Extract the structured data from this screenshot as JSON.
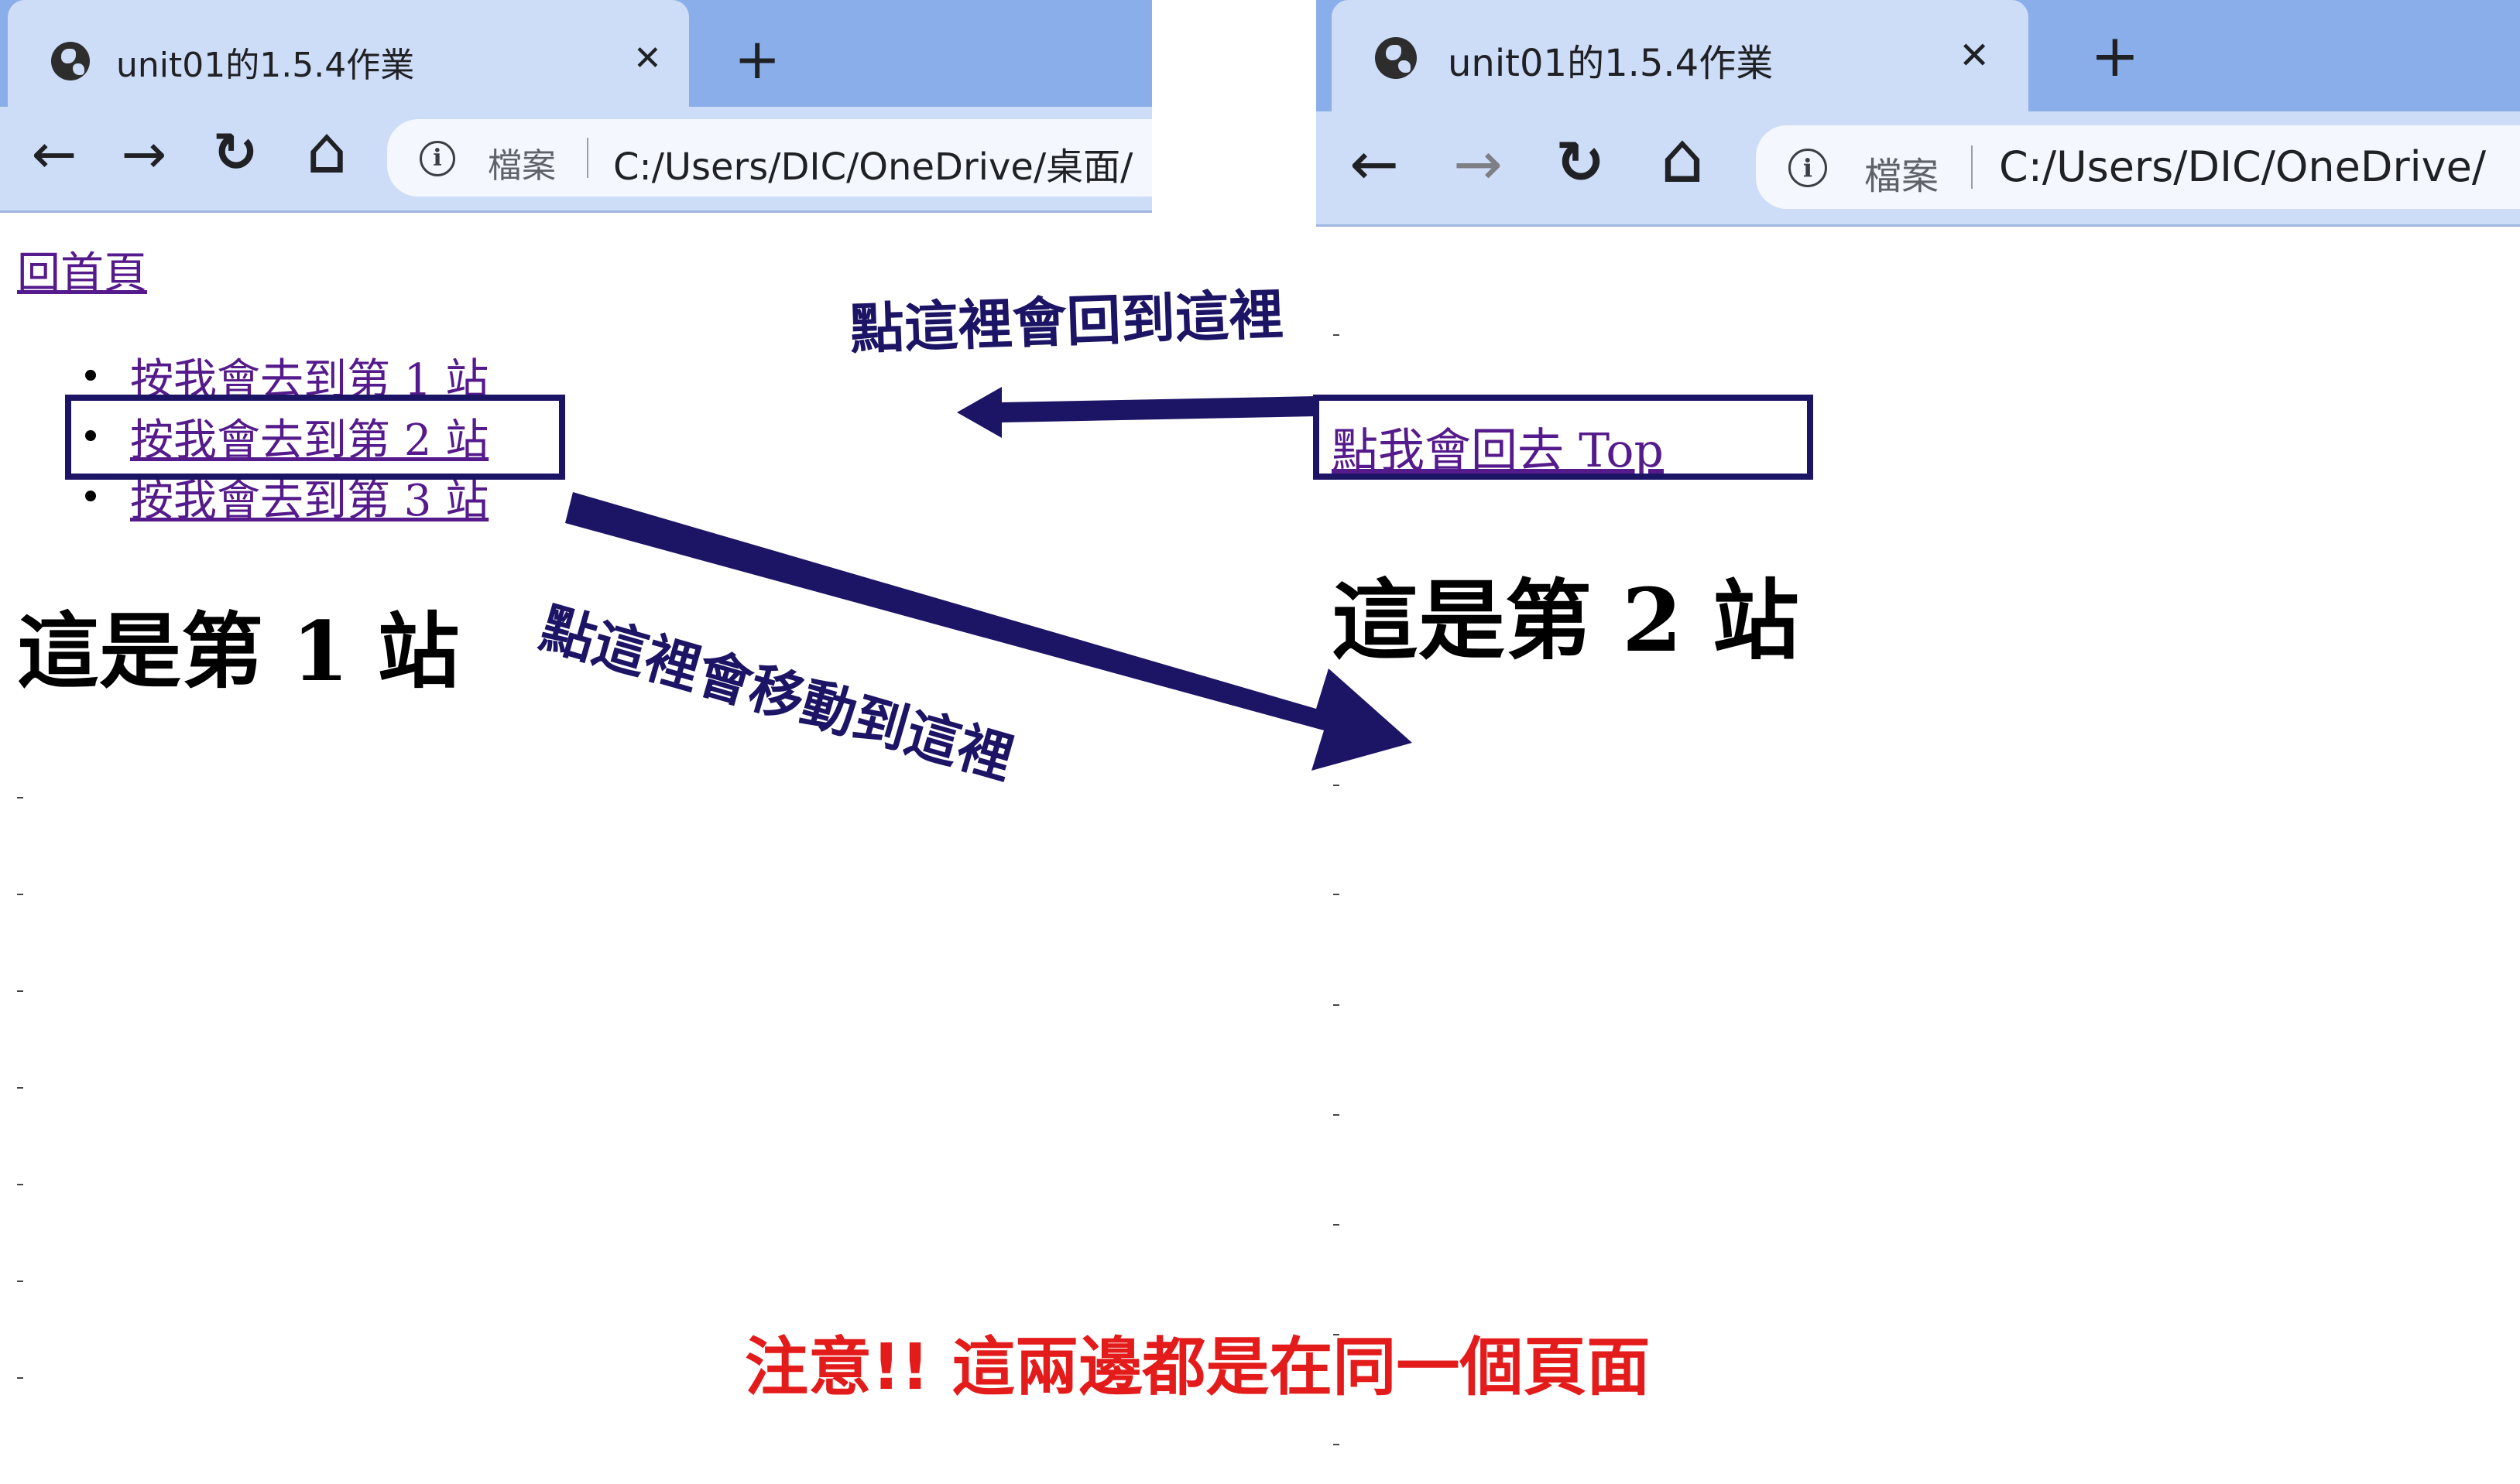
{
  "browser_left": {
    "tab_title": "unit01的1.5.4作業",
    "new_tab": "+",
    "close": "✕",
    "scheme_label": "檔案",
    "url": "C:/Users/DIC/OneDrive/桌面/"
  },
  "browser_right": {
    "tab_title": "unit01的1.5.4作業",
    "new_tab": "+",
    "close": "✕",
    "scheme_label": "檔案",
    "url": "C:/Users/DIC/OneDrive/"
  },
  "nav": {
    "back": "←",
    "forward": "→",
    "reload": "↻",
    "home": "⌂",
    "info": "i"
  },
  "page_left": {
    "home_link": "回首頁",
    "list_items": [
      "按我會去到第 1 站",
      "按我會去到第 2 站",
      "按我會去到第 3 站"
    ],
    "heading": "這是第 1 站"
  },
  "page_right": {
    "top_link": "點我會回去 Top",
    "heading": "這是第 2 站"
  },
  "annotations": {
    "back_note": "點這裡會回到這裡",
    "move_note": "點這裡會移動到這裡",
    "warning": "注意!! 這兩邊都是在同一個頁面"
  },
  "colors": {
    "annotation": "#1c1465",
    "warning": "#e31b1b",
    "link": "#551a8b",
    "tab_strip": "#8aaeea",
    "toolbar": "#cddcf7"
  }
}
